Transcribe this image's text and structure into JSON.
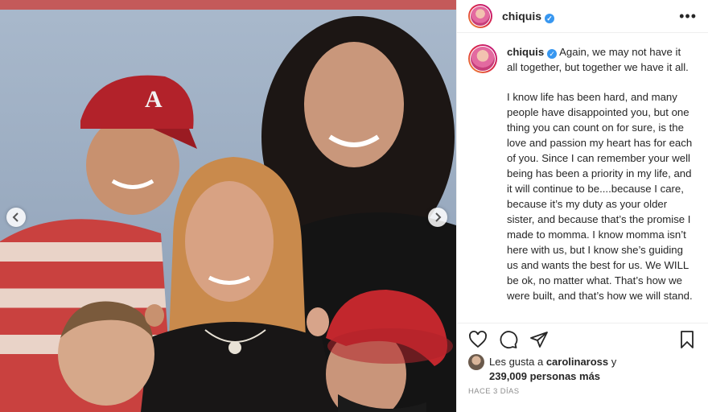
{
  "post": {
    "username": "chiquis",
    "verified_mark": "✓",
    "more_icon": "more-horizontal-icon",
    "caption_paragraphs": [
      "Again, we may not have it all together, but together we have it all.",
      "I know life has been hard, and many people have disappointed you, but one thing you can count on for sure, is the love and passion my heart has for each of you. Since I can remember your well being has been a priority in my life, and it will continue to be....because I care, because it’s my duty as your older sister, and because that’s the promise I made to momma. I know momma isn’t here with us, but I know she’s guiding us and wants the best for us. We WILL be ok, no matter what. That’s how we were built, and that’s how we will stand."
    ],
    "likes_prefix": "Les gusta a ",
    "likes_user": "carolinaross",
    "likes_mid": " y",
    "likes_count": "239,009 personas más",
    "timestamp": "HACE 3 DÍAS"
  },
  "icons": {
    "like": "heart-icon",
    "comment": "comment-icon",
    "share": "share-icon",
    "save": "bookmark-icon",
    "prev": "chevron-left-icon",
    "next": "chevron-right-icon"
  },
  "colors": {
    "verified": "#3897f0",
    "text": "#262626",
    "muted": "#8e8e8e",
    "border": "#efefef"
  }
}
